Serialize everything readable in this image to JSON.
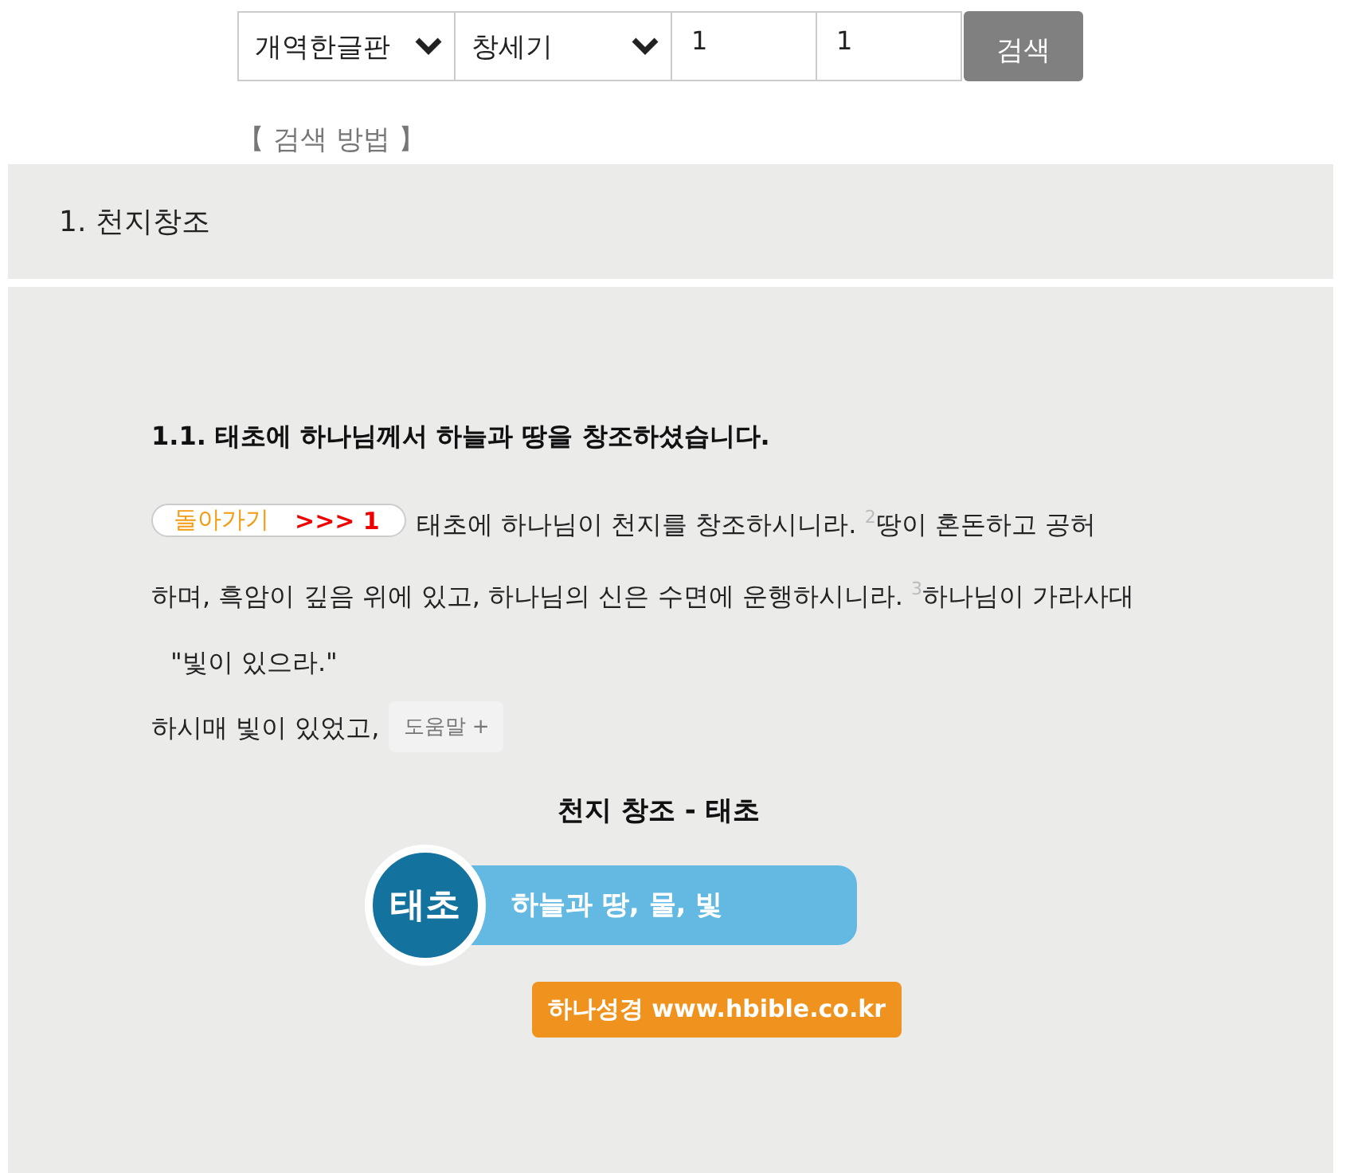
{
  "search_bar": {
    "version": "개역한글판",
    "book": "창세기",
    "chapter": "1",
    "verse": "1",
    "button": "검색"
  },
  "help_link": "【 검색 방법 】",
  "section_title": "1. 천지창조",
  "passage": {
    "heading": "1.1. 태초에 하나님께서 하늘과 땅을 창조하셨습니다.",
    "back_button": {
      "label": "돌아가기",
      "target": ">>> 1"
    },
    "verse_lines": [
      "태초에 하나님이 천지를 창조하시니라. $^{2}$땅이 혼돈하고 공허",
      "하며, 흑암이 깊음 위에 있고, 하나님의 신은 수면에 운행하시니라. $^{3}$하나님이 가라사대"
    ],
    "quote": "\"빛이 있으라.\"",
    "closing": "하시매 빛이 있었고,",
    "note_button": "도움말 +"
  },
  "diagram": {
    "title": "천지 창조 - 태초",
    "badge": "태초",
    "banner": "하늘과 땅, 물, 빛",
    "credit": "하나성경 www.hbible.co.kr"
  }
}
